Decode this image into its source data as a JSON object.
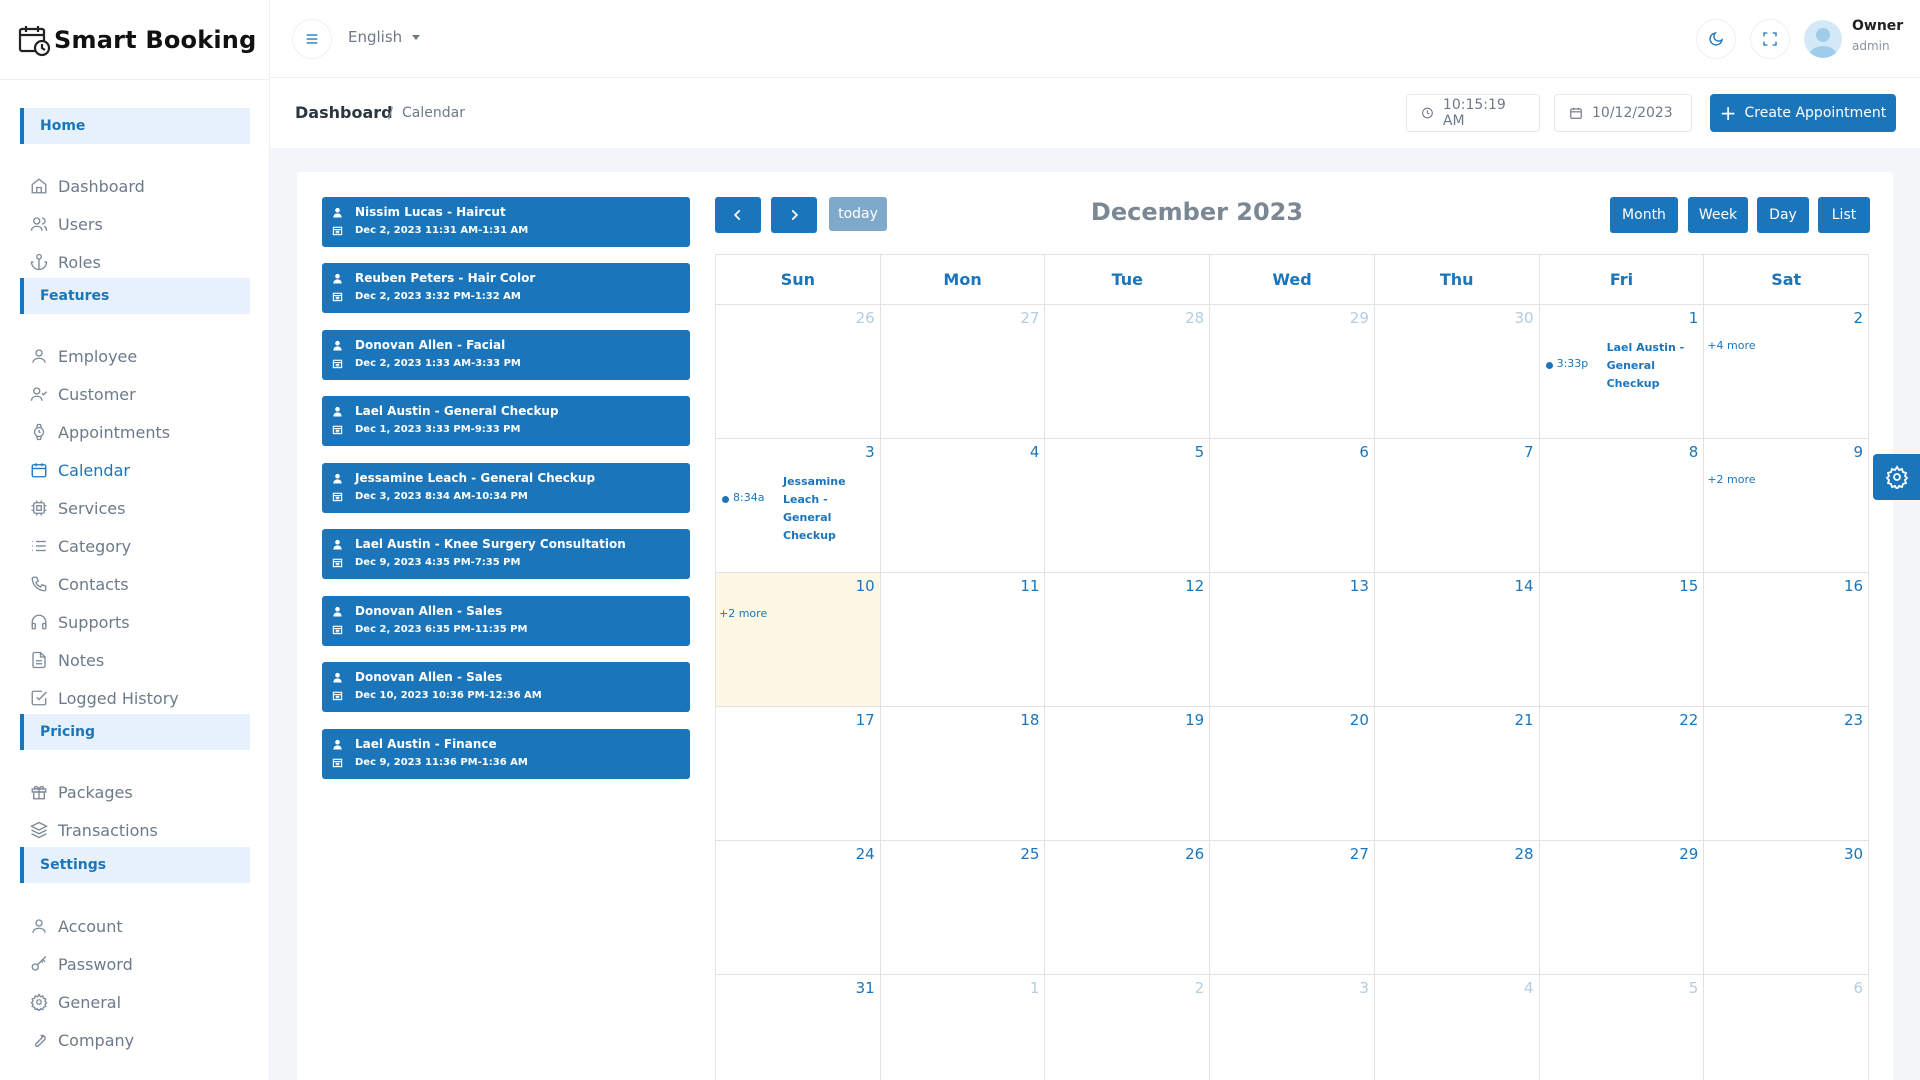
{
  "brand": {
    "name": "Smart Booking"
  },
  "sidebar": {
    "sections": [
      {
        "label": "Home",
        "items": [
          {
            "label": "Dashboard",
            "icon": "home-icon"
          },
          {
            "label": "Users",
            "icon": "users-icon"
          },
          {
            "label": "Roles",
            "icon": "anchor-icon"
          }
        ]
      },
      {
        "label": "Features",
        "items": [
          {
            "label": "Employee",
            "icon": "user-icon"
          },
          {
            "label": "Customer",
            "icon": "user-check-icon"
          },
          {
            "label": "Appointments",
            "icon": "watch-icon"
          },
          {
            "label": "Calendar",
            "icon": "calendar-icon",
            "active": true
          },
          {
            "label": "Services",
            "icon": "cpu-icon"
          },
          {
            "label": "Category",
            "icon": "list-icon"
          },
          {
            "label": "Contacts",
            "icon": "phone-icon"
          },
          {
            "label": "Supports",
            "icon": "headphones-icon"
          },
          {
            "label": "Notes",
            "icon": "file-text-icon"
          },
          {
            "label": "Logged History",
            "icon": "check-square-icon"
          }
        ]
      },
      {
        "label": "Pricing",
        "items": [
          {
            "label": "Packages",
            "icon": "gift-icon"
          },
          {
            "label": "Transactions",
            "icon": "layers-icon"
          }
        ]
      },
      {
        "label": "Settings",
        "items": [
          {
            "label": "Account",
            "icon": "user-icon"
          },
          {
            "label": "Password",
            "icon": "key-icon"
          },
          {
            "label": "General",
            "icon": "settings-icon"
          },
          {
            "label": "Company",
            "icon": "tool-icon"
          }
        ]
      }
    ]
  },
  "topbar": {
    "language": "English",
    "user_name": "Owner",
    "user_role": "admin"
  },
  "breadcrumb": {
    "main": "Dashboard",
    "separator": "/",
    "current": "Calendar"
  },
  "header": {
    "time": "10:15:19 AM",
    "date": "10/12/2023",
    "create_label": "Create Appointment"
  },
  "events": [
    {
      "title": "Nissim Lucas - Haircut",
      "time": "Dec 2, 2023 11:31 AM-1:31 AM"
    },
    {
      "title": "Reuben Peters - Hair Color",
      "time": "Dec 2, 2023 3:32 PM-1:32 AM"
    },
    {
      "title": "Donovan Allen - Facial",
      "time": "Dec 2, 2023 1:33 AM-3:33 PM"
    },
    {
      "title": "Lael Austin - General Checkup",
      "time": "Dec 1, 2023 3:33 PM-9:33 PM"
    },
    {
      "title": "Jessamine Leach - General Checkup",
      "time": "Dec 3, 2023 8:34 AM-10:34 PM"
    },
    {
      "title": "Lael Austin - Knee Surgery Consultation",
      "time": "Dec 9, 2023 4:35 PM-7:35 PM"
    },
    {
      "title": "Donovan Allen - Sales",
      "time": "Dec 2, 2023 6:35 PM-11:35 PM"
    },
    {
      "title": "Donovan Allen - Sales",
      "time": "Dec 10, 2023 10:36 PM-12:36 AM"
    },
    {
      "title": "Lael Austin - Finance",
      "time": "Dec 9, 2023 11:36 PM-1:36 AM"
    }
  ],
  "calendar": {
    "title": "December 2023",
    "today_label": "today",
    "views": [
      "Month",
      "Week",
      "Day",
      "List"
    ],
    "weekdays": [
      "Sun",
      "Mon",
      "Tue",
      "Wed",
      "Thu",
      "Fri",
      "Sat"
    ],
    "weeks": [
      [
        {
          "d": "26",
          "o": true
        },
        {
          "d": "27",
          "o": true
        },
        {
          "d": "28",
          "o": true
        },
        {
          "d": "29",
          "o": true
        },
        {
          "d": "30",
          "o": true
        },
        {
          "d": "1",
          "ev": {
            "time": "3:33p",
            "title": "Lael Austin - General Checkup"
          }
        },
        {
          "d": "2",
          "more": "+4 more"
        }
      ],
      [
        {
          "d": "3",
          "ev": {
            "time": "8:34a",
            "title": "Jessamine Leach - General Checkup"
          }
        },
        {
          "d": "4"
        },
        {
          "d": "5"
        },
        {
          "d": "6"
        },
        {
          "d": "7"
        },
        {
          "d": "8"
        },
        {
          "d": "9",
          "more": "+2 more"
        }
      ],
      [
        {
          "d": "10",
          "more": "+2 more",
          "today": true
        },
        {
          "d": "11"
        },
        {
          "d": "12"
        },
        {
          "d": "13"
        },
        {
          "d": "14"
        },
        {
          "d": "15"
        },
        {
          "d": "16"
        }
      ],
      [
        {
          "d": "17"
        },
        {
          "d": "18"
        },
        {
          "d": "19"
        },
        {
          "d": "20"
        },
        {
          "d": "21"
        },
        {
          "d": "22"
        },
        {
          "d": "23"
        }
      ],
      [
        {
          "d": "24"
        },
        {
          "d": "25"
        },
        {
          "d": "26"
        },
        {
          "d": "27"
        },
        {
          "d": "28"
        },
        {
          "d": "29"
        },
        {
          "d": "30"
        }
      ],
      [
        {
          "d": "31"
        },
        {
          "d": "1",
          "o": true
        },
        {
          "d": "2",
          "o": true
        },
        {
          "d": "3",
          "o": true
        },
        {
          "d": "4",
          "o": true
        },
        {
          "d": "5",
          "o": true
        },
        {
          "d": "6",
          "o": true
        }
      ]
    ]
  },
  "colors": {
    "primary": "#1b75bb",
    "today_bg": "#fcf8e3",
    "section_bg": "#e7f1fb"
  }
}
